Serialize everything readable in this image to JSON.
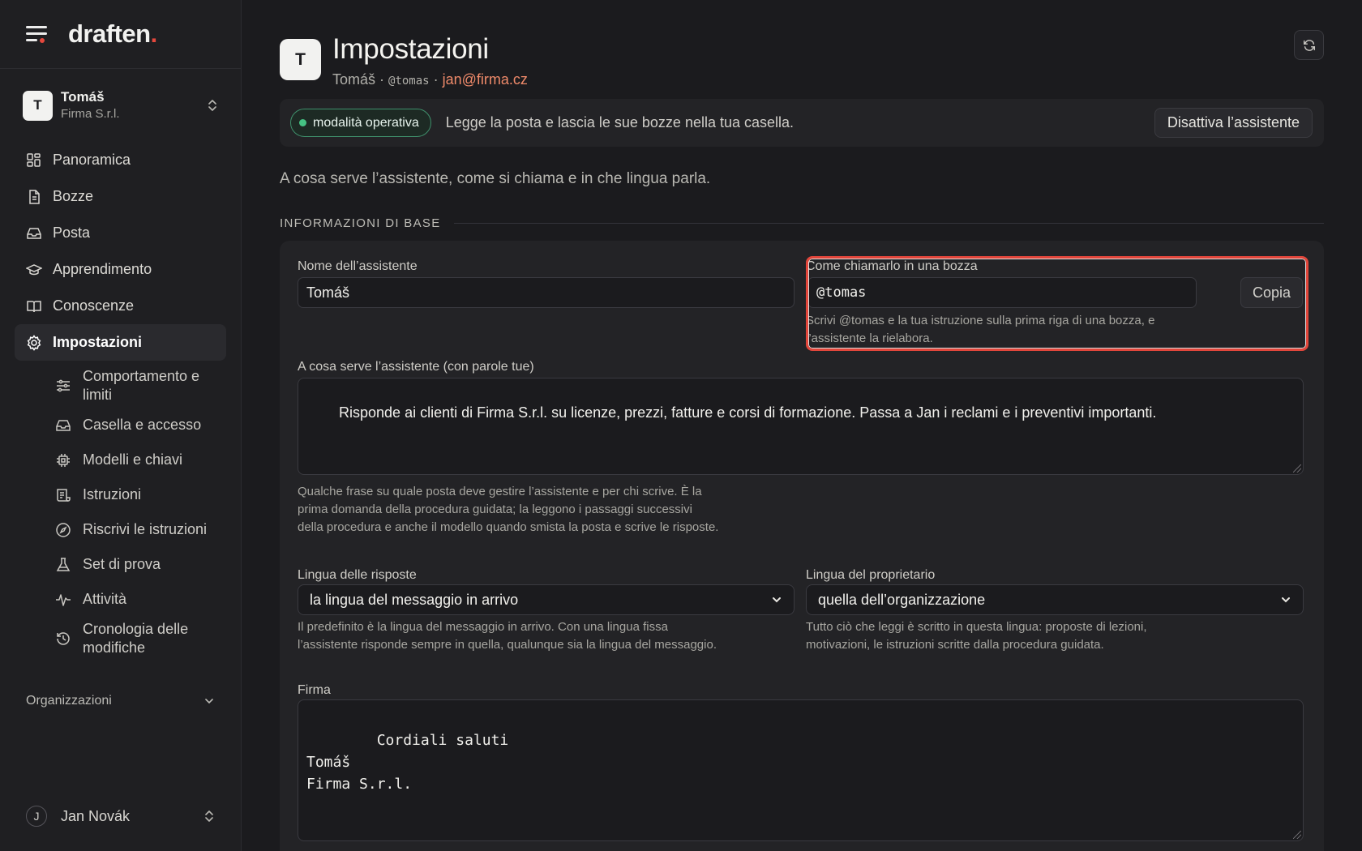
{
  "brand": {
    "name": "draften",
    "dot": "."
  },
  "account": {
    "initial": "T",
    "name": "Tomáš",
    "org": "Firma S.r.l."
  },
  "nav": {
    "items": [
      {
        "label": "Panoramica",
        "icon": "grid-icon"
      },
      {
        "label": "Bozze",
        "icon": "document-icon"
      },
      {
        "label": "Posta",
        "icon": "inbox-icon"
      },
      {
        "label": "Apprendimento",
        "icon": "graduation-cap-icon"
      },
      {
        "label": "Conoscenze",
        "icon": "book-icon"
      },
      {
        "label": "Impostazioni",
        "icon": "gear-icon",
        "active": true
      }
    ],
    "sub_items": [
      {
        "label": "Comportamento e limiti",
        "icon": "sliders-icon"
      },
      {
        "label": "Casella e accesso",
        "icon": "inbox-icon"
      },
      {
        "label": "Modelli e chiavi",
        "icon": "chip-icon"
      },
      {
        "label": "Istruzioni",
        "icon": "scroll-icon"
      },
      {
        "label": "Riscrivi le istruzioni",
        "icon": "compass-icon"
      },
      {
        "label": "Set di prova",
        "icon": "flask-icon"
      },
      {
        "label": "Attività",
        "icon": "activity-icon"
      },
      {
        "label": "Cronologia delle modifiche",
        "icon": "history-icon"
      }
    ],
    "organizations_label": "Organizzazioni"
  },
  "user": {
    "initial": "J",
    "name": "Jan Novák"
  },
  "header": {
    "initial": "T",
    "title": "Impostazioni",
    "sub_name": "Tomáš",
    "sep1": " · ",
    "handle": "@tomas",
    "sep2": " · ",
    "email": "jan@firma.cz"
  },
  "status": {
    "badge": "modalità operativa",
    "text": "Legge la posta e lascia le sue bozze nella tua casella.",
    "disable_button": "Disattiva l’assistente"
  },
  "intro": "A cosa serve l’assistente, come si chiama e in che lingua parla.",
  "section_title": "INFORMAZIONI DI BASE",
  "form": {
    "name_label": "Nome dell’assistente",
    "name_value": "Tomáš",
    "mention_label": "Come chiamarlo in una bozza",
    "mention_value": "@tomas",
    "copy_button": "Copia",
    "mention_help": "Scrivi @tomas e la tua istruzione sulla prima riga di una bozza, e l’assistente la rielabora.",
    "purpose_label": "A cosa serve l’assistente (con parole tue)",
    "purpose_value": "Risponde ai clienti di Firma S.r.l. su licenze, prezzi, fatture e corsi di formazione. Passa a Jan i reclami e i preventivi importanti.",
    "purpose_help": "Qualche frase su quale posta deve gestire l’assistente e per chi scrive. È la prima domanda della procedura guidata; la leggono i passaggi successivi della procedura e anche il modello quando smista la posta e scrive le risposte.",
    "reply_lang_label": "Lingua delle risposte",
    "reply_lang_value": "la lingua del messaggio in arrivo",
    "reply_lang_help": "Il predefinito è la lingua del messaggio in arrivo. Con una lingua fissa l’assistente risponde sempre in quella, qualunque sia la lingua del messaggio.",
    "owner_lang_label": "Lingua del proprietario",
    "owner_lang_value": "quella dell’organizzazione",
    "owner_lang_help": "Tutto ciò che leggi è scritto in questa lingua: proposte di lezioni, motivazioni, le istruzioni scritte dalla procedura guidata.",
    "signature_label": "Firma",
    "signature_value": "Cordiali saluti\nTomáš\nFirma S.r.l."
  },
  "colors": {
    "accent": "#e5483d",
    "email": "#ef8a6a",
    "status_green": "#45c283",
    "highlight": "#e2463b"
  }
}
